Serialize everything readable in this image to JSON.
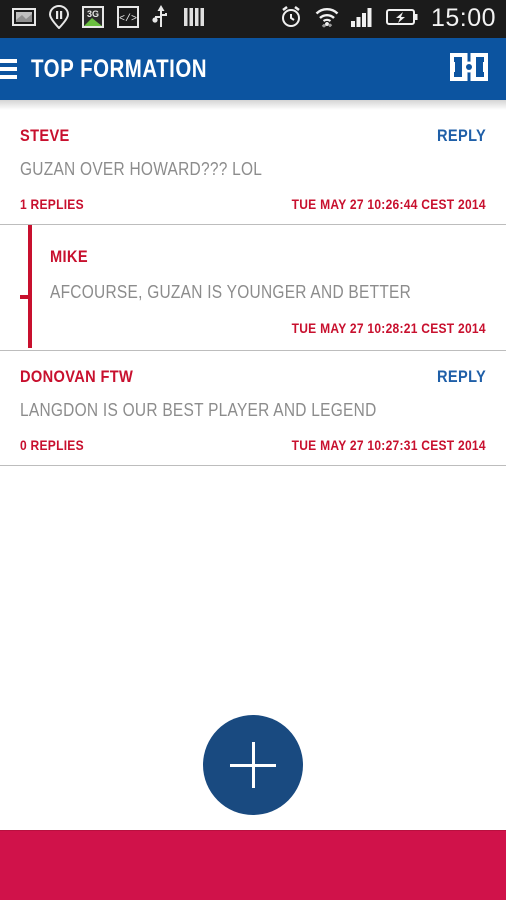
{
  "statusbar": {
    "time": "15:00",
    "left_icons": [
      "screenshot-icon",
      "pause-location-icon",
      "3g-icon",
      "code-icon",
      "usb-icon",
      "signal-bars-icon"
    ],
    "right_icons": [
      "alarm-icon",
      "wifi-icon",
      "cellular-signal-icon",
      "battery-charging-icon"
    ],
    "background": "#1b1b1b"
  },
  "appbar": {
    "title": "TOP FORMATION",
    "menu_icon": "hamburger-icon",
    "action_icon": "soccer-pitch-icon",
    "background": "#0c54a0",
    "text_color": "#ffffff"
  },
  "colors": {
    "accent_red": "#c8102e",
    "link_blue": "#1f5fa8",
    "body_gray": "#8c8c8c",
    "fab_blue": "#194a80",
    "bottom_bar_red": "#d0124a"
  },
  "posts": [
    {
      "author": "STEVE",
      "reply_label": "REPLY",
      "body": "GUZAN OVER HOWARD??? LOL",
      "replies_count": "1 REPLIES",
      "timestamp": "TUE MAY 27 10:26:44 CEST 2014",
      "replies": [
        {
          "author": "MIKE",
          "body": "AFCOURSE, GUZAN IS YOUNGER AND BETTER",
          "timestamp": "TUE MAY 27 10:28:21 CEST 2014"
        }
      ]
    },
    {
      "author": "DONOVAN FTW",
      "reply_label": "REPLY",
      "body": "LANGDON IS OUR BEST PLAYER AND LEGEND",
      "replies_count": "0 REPLIES",
      "timestamp": "TUE MAY 27 10:27:31 CEST 2014",
      "replies": []
    }
  ],
  "fab": {
    "icon": "plus-icon",
    "label": "+"
  }
}
